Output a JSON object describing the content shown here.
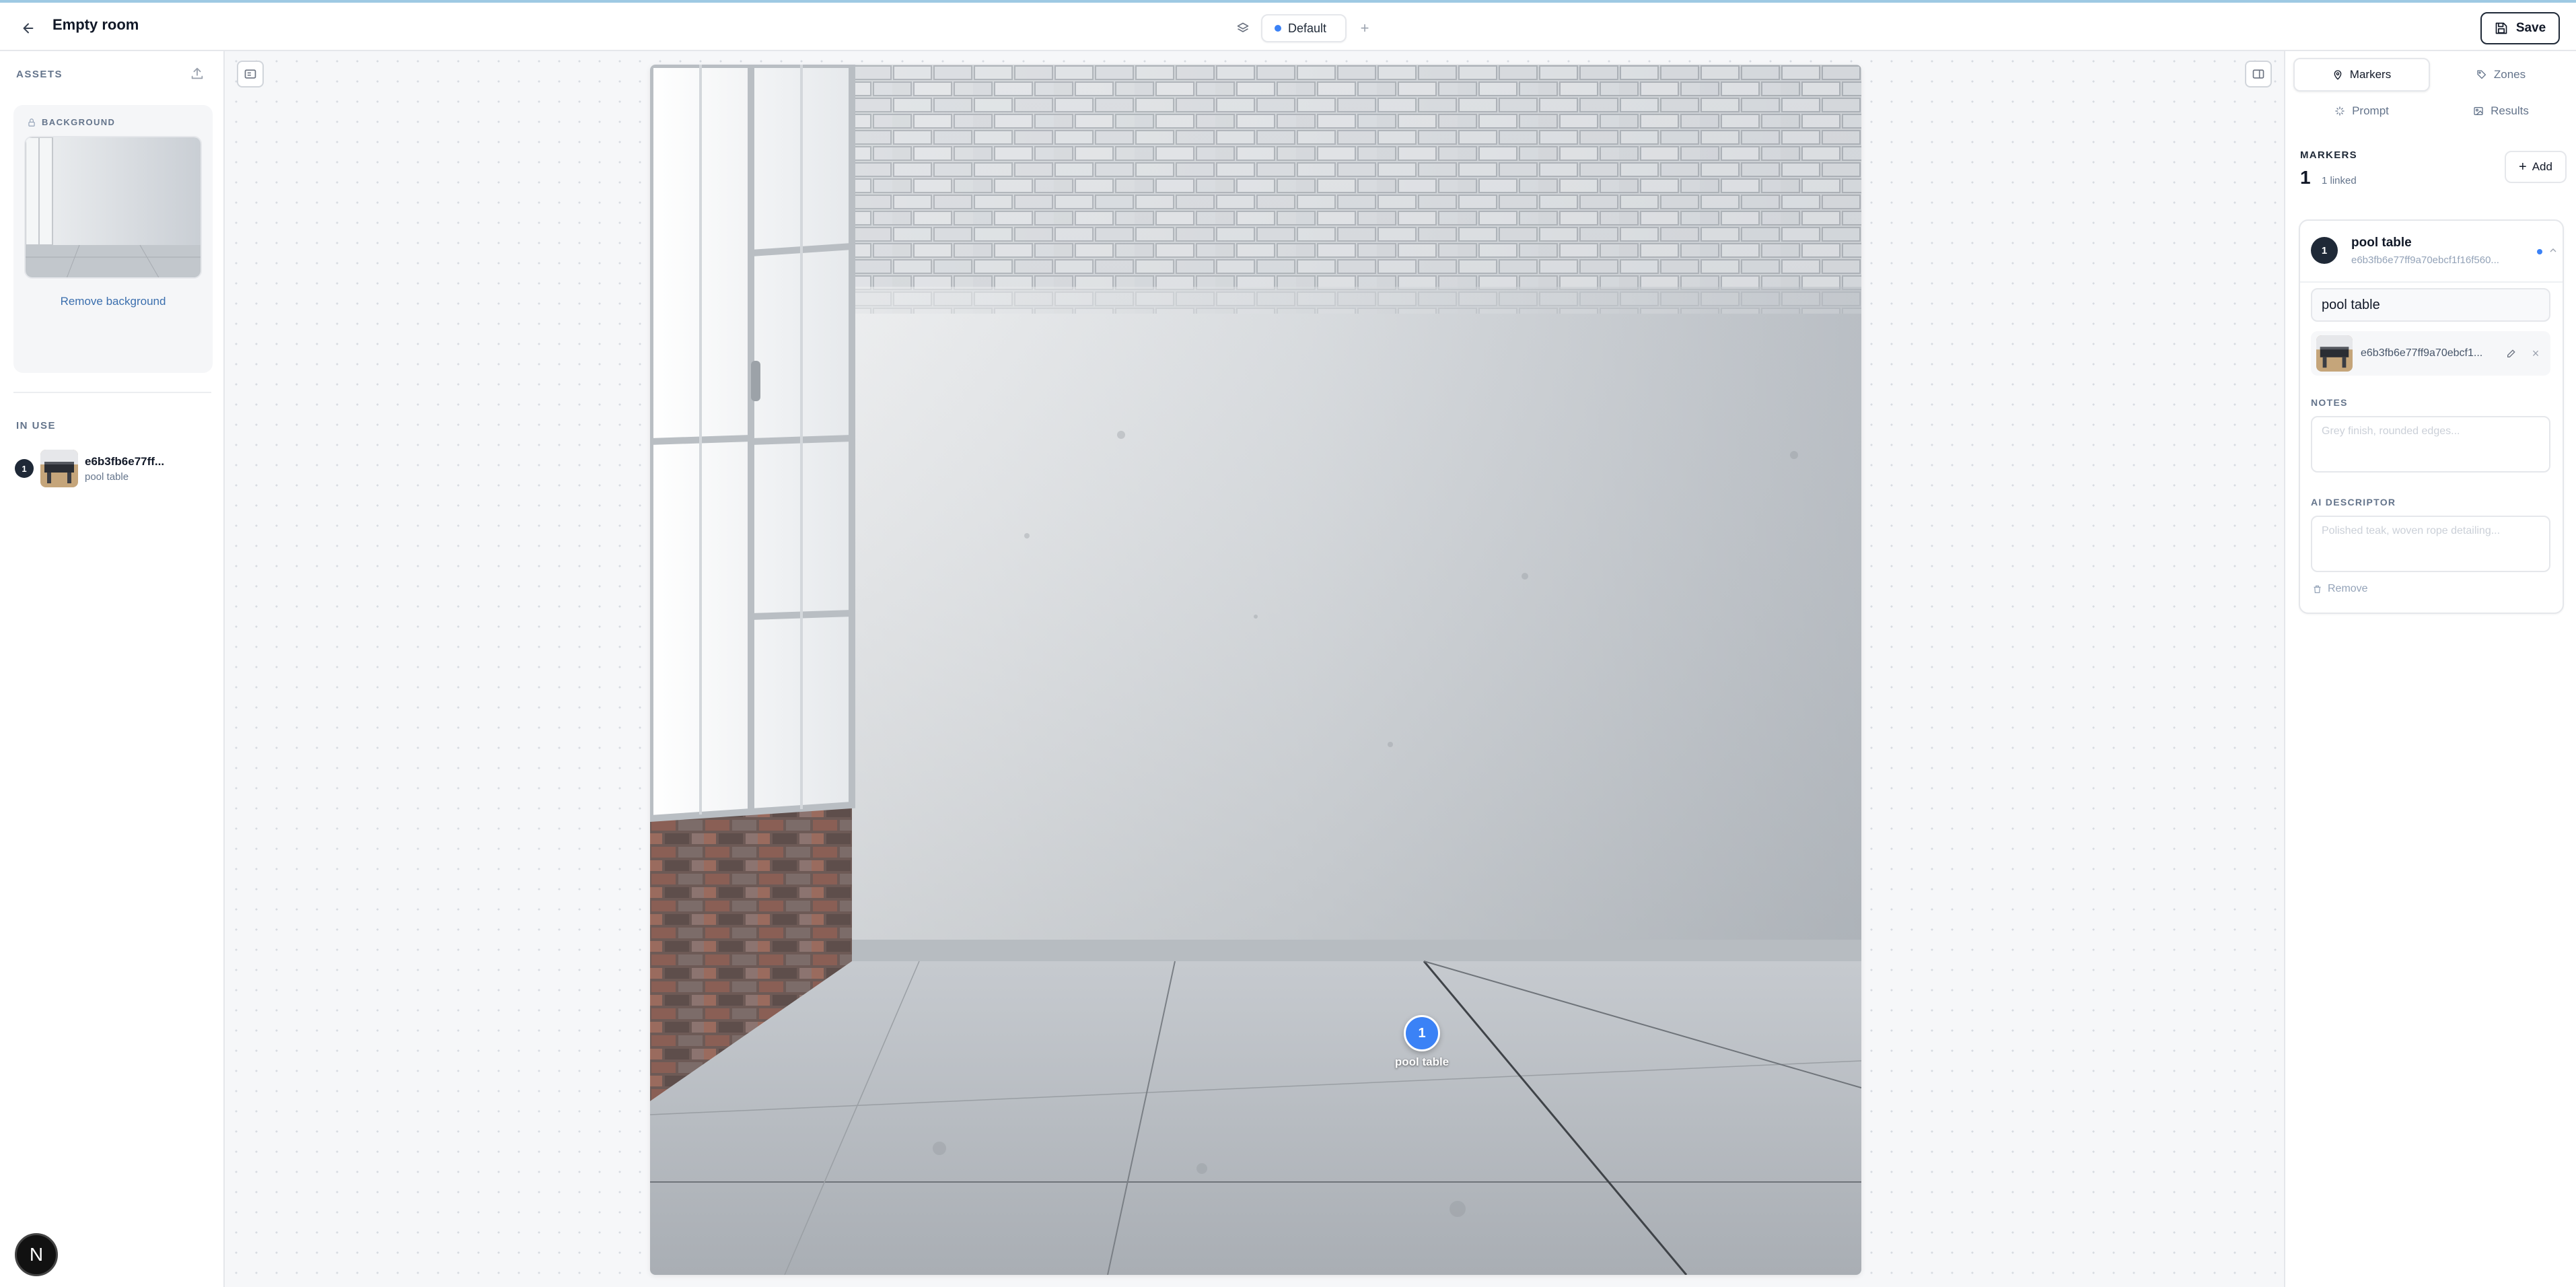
{
  "header": {
    "title": "Empty room",
    "variant_label": "Default",
    "save_label": "Save"
  },
  "left": {
    "assets_heading": "ASSETS",
    "background_label": "BACKGROUND",
    "remove_background": "Remove background",
    "in_use_heading": "IN USE",
    "in_use_items": [
      {
        "number": "1",
        "title": "e6b3fb6e77ff...",
        "subtitle": "pool table"
      }
    ],
    "avatar_letter": "N"
  },
  "canvas": {
    "marker_number": "1",
    "marker_label": "pool table"
  },
  "right": {
    "tabs": [
      {
        "label": "Markers",
        "icon": "map-pin-icon",
        "active": true
      },
      {
        "label": "Zones",
        "icon": "tag-icon",
        "active": false
      },
      {
        "label": "Prompt",
        "icon": "sparkles-icon",
        "active": false
      },
      {
        "label": "Results",
        "icon": "image-icon",
        "active": false
      }
    ],
    "markers_heading": "MARKERS",
    "markers_count": "1",
    "linked_text": "1 linked",
    "add_label": "Add",
    "card": {
      "number": "1",
      "title": "pool table",
      "hash": "e6b3fb6e77ff9a70ebcf1f16f560...",
      "name_value": "pool table",
      "asset_name": "e6b3fb6e77ff9a70ebcf1...",
      "notes_label": "NOTES",
      "notes_placeholder": "Grey finish, rounded edges...",
      "ai_label": "AI DESCRIPTOR",
      "ai_placeholder": "Polished teak, woven rope detailing...",
      "remove_label": "Remove"
    }
  },
  "colors": {
    "accent": "#3b82f6",
    "dark_badge": "#1f2937",
    "link": "#3b6fae"
  }
}
